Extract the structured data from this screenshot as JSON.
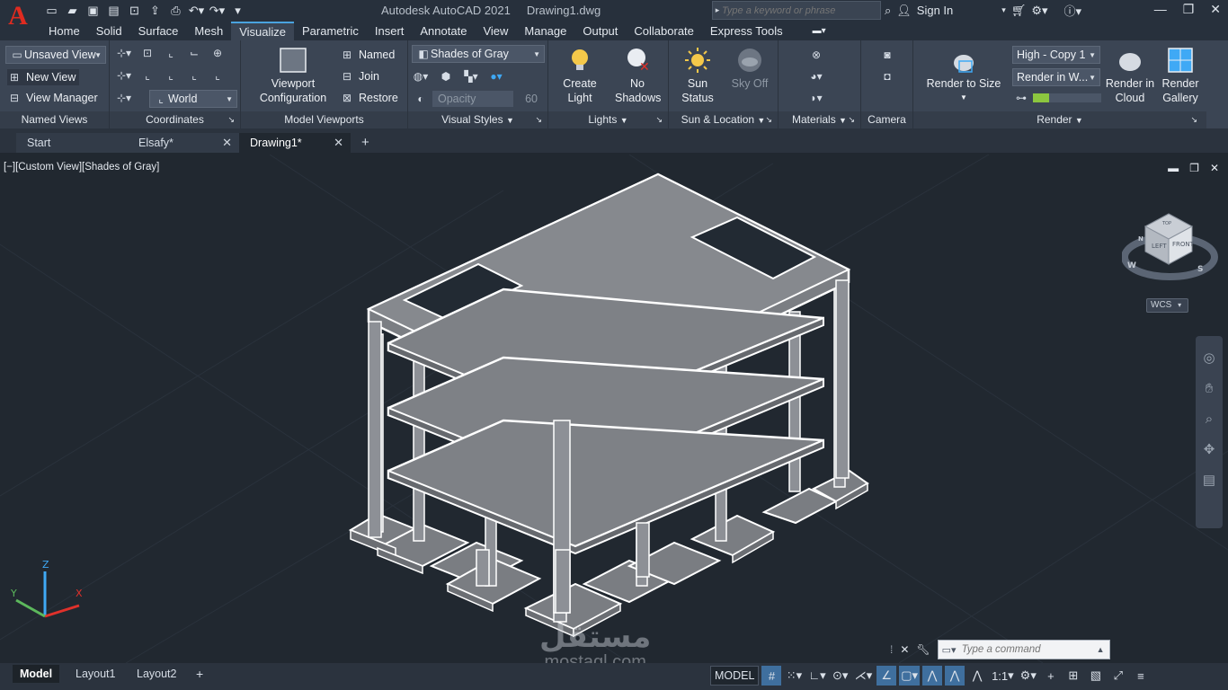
{
  "app": {
    "logo_letter": "A",
    "name": "Autodesk AutoCAD 2021",
    "document": "Drawing1.dwg"
  },
  "search": {
    "placeholder": "Type a keyword or phrase"
  },
  "account": {
    "sign_in": "Sign In"
  },
  "ribbon_tabs": [
    "Home",
    "Solid",
    "Surface",
    "Mesh",
    "Visualize",
    "Parametric",
    "Insert",
    "Annotate",
    "View",
    "Manage",
    "Output",
    "Collaborate",
    "Express Tools"
  ],
  "active_tab": "Visualize",
  "panels": {
    "named_views": {
      "title": "Named Views",
      "combo": "Unsaved View",
      "new_view": "New View",
      "view_manager": "View Manager"
    },
    "coordinates": {
      "title": "Coordinates",
      "ucs_combo": "World"
    },
    "model_viewports": {
      "title": "Model Viewports",
      "viewport_config": "Viewport Configuration",
      "named": "Named",
      "join": "Join",
      "restore": "Restore"
    },
    "visual_styles": {
      "title": "Visual Styles",
      "combo": "Shades of Gray",
      "opacity_label": "Opacity",
      "opacity_value": "60"
    },
    "lights": {
      "title": "Lights",
      "create_light": "Create Light",
      "no_shadows": "No Shadows"
    },
    "sun_location": {
      "title": "Sun & Location",
      "sun_status": "Sun Status",
      "sky_off": "Sky Off"
    },
    "materials": {
      "title": "Materials"
    },
    "camera": {
      "title": "Camera"
    },
    "render": {
      "title": "Render",
      "render_to_size": "Render to Size",
      "preset_combo": "High - Copy 1",
      "target_combo": "Render in W...",
      "render_in_cloud": "Render in Cloud",
      "render_gallery": "Render Gallery"
    }
  },
  "file_tabs": [
    {
      "label": "Start"
    },
    {
      "label": "Elsafy*"
    },
    {
      "label": "Drawing1*"
    }
  ],
  "viewport": {
    "label": "[−][Custom View][Shades of Gray]",
    "wcs": "WCS",
    "viewcube": {
      "left": "LEFT",
      "front": "FRONT",
      "top": "TOP"
    },
    "compass": {
      "n": "N",
      "w": "W",
      "s": "S"
    },
    "ucs": {
      "x": "X",
      "y": "Y",
      "z": "Z"
    }
  },
  "watermark": {
    "arabic": "مستقل",
    "latin": "mostaql.com"
  },
  "command": {
    "placeholder": "Type a command"
  },
  "layout_tabs": [
    "Model",
    "Layout1",
    "Layout2"
  ],
  "status": {
    "model": "MODEL",
    "scale": "1:1"
  },
  "colors": {
    "accent": "#4aa3df",
    "logo": "#e02b20",
    "ribbon_bg": "#3b4554",
    "viewport_bg": "#212830"
  }
}
